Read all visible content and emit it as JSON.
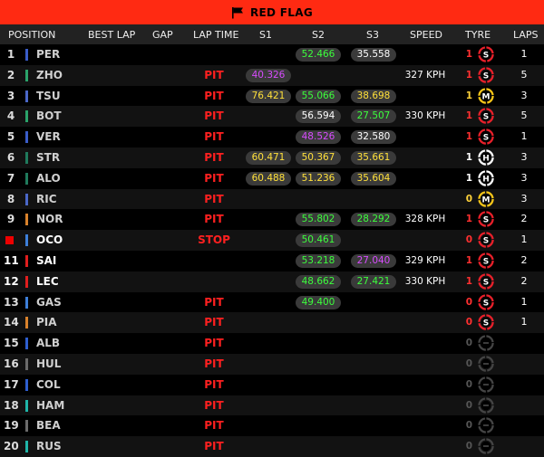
{
  "banner": {
    "label": "RED FLAG"
  },
  "header": {
    "position": "POSITION",
    "best_lap": "BEST LAP",
    "gap": "GAP",
    "lap_time": "LAP TIME",
    "s1": "S1",
    "s2": "S2",
    "s3": "S3",
    "speed": "SPEED",
    "tyre": "TYRE",
    "laps": "LAPS"
  },
  "colors": {
    "banner": "#ff2a12",
    "pit": "#ff2020",
    "sector_green": "#3cff3c",
    "sector_yellow": "#ffe03a",
    "sector_purple": "#d84cff",
    "soft": "#e8202a",
    "medium": "#f5c518",
    "hard": "#ffffff"
  },
  "rows": [
    {
      "pos": "1",
      "drv": "PER",
      "team": "#3a5dc9",
      "lt": "",
      "s1": "",
      "s1c": "",
      "s2": "52.466",
      "s2c": "g",
      "s3": "35.558",
      "s3c": "w",
      "spd": "",
      "tc": "1",
      "tcc": "red",
      "tyre": "S",
      "laps": "1"
    },
    {
      "pos": "2",
      "drv": "ZHO",
      "team": "#2aa36a",
      "lt": "PIT",
      "s1": "40.326",
      "s1c": "p",
      "s2": "",
      "s2c": "",
      "s3": "",
      "s3c": "",
      "spd": "327 KPH",
      "tc": "1",
      "tcc": "red",
      "tyre": "S",
      "laps": "5"
    },
    {
      "pos": "3",
      "drv": "TSU",
      "team": "#4a67c8",
      "lt": "PIT",
      "s1": "76.421",
      "s1c": "y",
      "s2": "55.066",
      "s2c": "g",
      "s3": "38.698",
      "s3c": "y",
      "spd": "",
      "tc": "1",
      "tcc": "yel",
      "tyre": "M",
      "laps": "3"
    },
    {
      "pos": "4",
      "drv": "BOT",
      "team": "#2aa36a",
      "lt": "PIT",
      "s1": "",
      "s1c": "",
      "s2": "56.594",
      "s2c": "w",
      "s3": "27.507",
      "s3c": "g",
      "spd": "330 KPH",
      "tc": "1",
      "tcc": "red",
      "tyre": "S",
      "laps": "5"
    },
    {
      "pos": "5",
      "drv": "VER",
      "team": "#3a5dc9",
      "lt": "PIT",
      "s1": "",
      "s1c": "",
      "s2": "48.526",
      "s2c": "p",
      "s3": "32.580",
      "s3c": "w",
      "spd": "",
      "tc": "1",
      "tcc": "red",
      "tyre": "S",
      "laps": "1"
    },
    {
      "pos": "6",
      "drv": "STR",
      "team": "#1f7a5c",
      "lt": "PIT",
      "s1": "60.471",
      "s1c": "y",
      "s2": "50.367",
      "s2c": "y",
      "s3": "35.661",
      "s3c": "y",
      "spd": "",
      "tc": "1",
      "tcc": "wh",
      "tyre": "H",
      "laps": "3"
    },
    {
      "pos": "7",
      "drv": "ALO",
      "team": "#1f7a5c",
      "lt": "PIT",
      "s1": "60.488",
      "s1c": "y",
      "s2": "51.236",
      "s2c": "y",
      "s3": "35.604",
      "s3c": "y",
      "spd": "",
      "tc": "1",
      "tcc": "wh",
      "tyre": "H",
      "laps": "3"
    },
    {
      "pos": "8",
      "drv": "RIC",
      "team": "#4a67c8",
      "lt": "PIT",
      "s1": "",
      "s1c": "",
      "s2": "",
      "s2c": "",
      "s3": "",
      "s3c": "",
      "spd": "",
      "tc": "0",
      "tcc": "yel",
      "tyre": "M",
      "laps": "3"
    },
    {
      "pos": "9",
      "drv": "NOR",
      "team": "#d9822b",
      "lt": "PIT",
      "s1": "",
      "s1c": "",
      "s2": "55.802",
      "s2c": "g",
      "s3": "28.292",
      "s3c": "g",
      "spd": "328 KPH",
      "tc": "1",
      "tcc": "red",
      "tyre": "S",
      "laps": "2"
    },
    {
      "pos": "",
      "posbox": true,
      "drv": "OCO",
      "team": "#3d7fd9",
      "lt": "STOP",
      "s1": "",
      "s1c": "",
      "s2": "50.461",
      "s2c": "g",
      "s3": "",
      "s3c": "",
      "spd": "",
      "tc": "0",
      "tcc": "red",
      "tyre": "S",
      "laps": "1",
      "white": true
    },
    {
      "pos": "11",
      "drv": "SAI",
      "team": "#e01e1e",
      "lt": "",
      "s1": "",
      "s1c": "",
      "s2": "53.218",
      "s2c": "g",
      "s3": "27.040",
      "s3c": "p",
      "spd": "329 KPH",
      "tc": "1",
      "tcc": "red",
      "tyre": "S",
      "laps": "2",
      "white": true
    },
    {
      "pos": "12",
      "drv": "LEC",
      "team": "#e01e1e",
      "lt": "",
      "s1": "",
      "s1c": "",
      "s2": "48.662",
      "s2c": "g",
      "s3": "27.421",
      "s3c": "g",
      "spd": "330 KPH",
      "tc": "1",
      "tcc": "red",
      "tyre": "S",
      "laps": "2",
      "white": true
    },
    {
      "pos": "13",
      "drv": "GAS",
      "team": "#3d7fd9",
      "lt": "PIT",
      "s1": "",
      "s1c": "",
      "s2": "49.400",
      "s2c": "g",
      "s3": "",
      "s3c": "",
      "spd": "",
      "tc": "0",
      "tcc": "red",
      "tyre": "S",
      "laps": "1"
    },
    {
      "pos": "14",
      "drv": "PIA",
      "team": "#d9822b",
      "lt": "PIT",
      "s1": "",
      "s1c": "",
      "s2": "",
      "s2c": "",
      "s3": "",
      "s3c": "",
      "spd": "",
      "tc": "0",
      "tcc": "red",
      "tyre": "S",
      "laps": "1"
    },
    {
      "pos": "15",
      "drv": "ALB",
      "team": "#2e5fd0",
      "lt": "PIT",
      "s1": "",
      "s1c": "",
      "s2": "",
      "s2c": "",
      "s3": "",
      "s3c": "",
      "spd": "",
      "tc": "0",
      "tcc": "gray",
      "tyre": "",
      "laps": ""
    },
    {
      "pos": "16",
      "drv": "HUL",
      "team": "#6b6b6b",
      "lt": "PIT",
      "s1": "",
      "s1c": "",
      "s2": "",
      "s2c": "",
      "s3": "",
      "s3c": "",
      "spd": "",
      "tc": "0",
      "tcc": "gray",
      "tyre": "",
      "laps": ""
    },
    {
      "pos": "17",
      "drv": "COL",
      "team": "#2e5fd0",
      "lt": "PIT",
      "s1": "",
      "s1c": "",
      "s2": "",
      "s2c": "",
      "s3": "",
      "s3c": "",
      "spd": "",
      "tc": "0",
      "tcc": "gray",
      "tyre": "",
      "laps": ""
    },
    {
      "pos": "18",
      "drv": "HAM",
      "team": "#1fb5a8",
      "lt": "PIT",
      "s1": "",
      "s1c": "",
      "s2": "",
      "s2c": "",
      "s3": "",
      "s3c": "",
      "spd": "",
      "tc": "0",
      "tcc": "gray",
      "tyre": "",
      "laps": ""
    },
    {
      "pos": "19",
      "drv": "BEA",
      "team": "#6b6b6b",
      "lt": "PIT",
      "s1": "",
      "s1c": "",
      "s2": "",
      "s2c": "",
      "s3": "",
      "s3c": "",
      "spd": "",
      "tc": "0",
      "tcc": "gray",
      "tyre": "",
      "laps": ""
    },
    {
      "pos": "20",
      "drv": "RUS",
      "team": "#1fb5a8",
      "lt": "PIT",
      "s1": "",
      "s1c": "",
      "s2": "",
      "s2c": "",
      "s3": "",
      "s3c": "",
      "spd": "",
      "tc": "0",
      "tcc": "gray",
      "tyre": "",
      "laps": ""
    }
  ]
}
